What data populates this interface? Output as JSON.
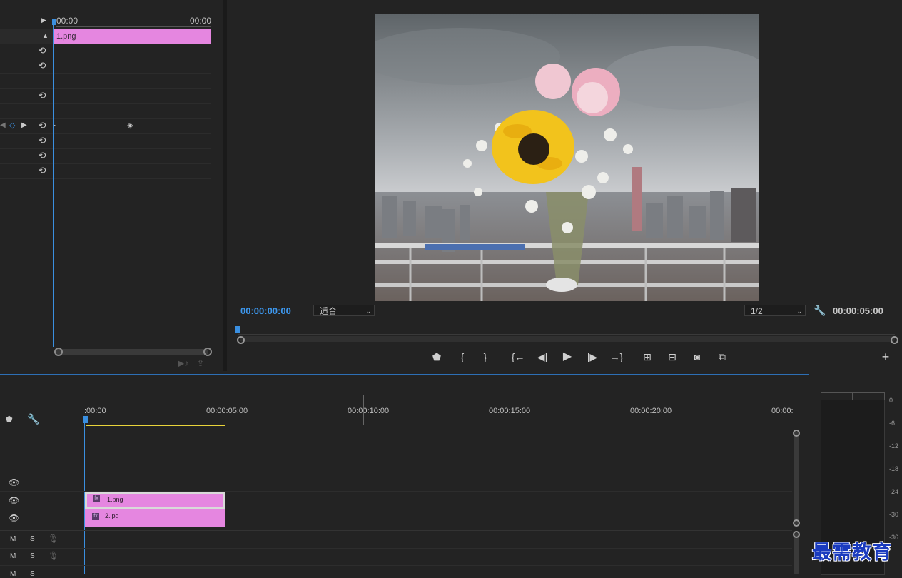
{
  "effect_controls": {
    "ruler_start": "00:00",
    "ruler_end": "00:00",
    "clip_name": "1.png"
  },
  "program_monitor": {
    "current_time": "00:00:00:00",
    "zoom_value": "适合",
    "resolution_value": "1/2",
    "duration": "00:00:05:00"
  },
  "timeline": {
    "ruler_labels": [
      ":00:00",
      "00:00:05:00",
      "00:00:10:00",
      "00:00:15:00",
      "00:00:20:00",
      "00:00:"
    ],
    "clips": {
      "v2": "1.png",
      "v1": "2.jpg"
    },
    "audio_buttons": {
      "mute": "M",
      "solo": "S"
    }
  },
  "audio_meter": {
    "scale": [
      "0",
      "-6",
      "-12",
      "-18",
      "-24",
      "-30",
      "-36"
    ]
  },
  "watermark": "最需教育",
  "colors": {
    "accent": "#3d98ef",
    "clip": "#e586e0",
    "work_area": "#e8d33a"
  }
}
